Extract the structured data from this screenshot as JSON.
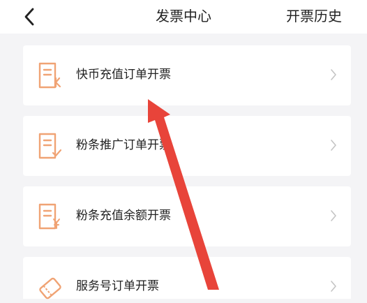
{
  "header": {
    "title": "发票中心",
    "history_label": "开票历史"
  },
  "items": [
    {
      "label": "快币充值订单开票",
      "icon": "receipt-k-icon"
    },
    {
      "label": "粉条推广订单开票",
      "icon": "receipt-check-icon"
    },
    {
      "label": "粉条充值余额开票",
      "icon": "receipt-yen-icon"
    },
    {
      "label": "服务号订单开票",
      "icon": "service-ticket-icon"
    }
  ],
  "colors": {
    "accent_orange": "#f0a374",
    "annotation_arrow": "#e8443a",
    "background": "#f4f4f6"
  }
}
